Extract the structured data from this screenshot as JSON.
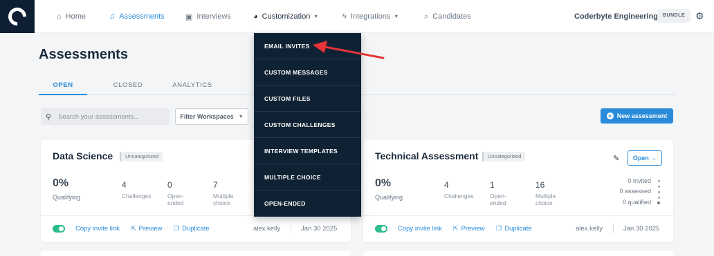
{
  "nav": {
    "items": [
      {
        "label": "Home",
        "icon": "home-icon"
      },
      {
        "label": "Assessments",
        "icon": "assessments-icon"
      },
      {
        "label": "Interviews",
        "icon": "interviews-icon"
      },
      {
        "label": "Customization",
        "icon": "palette-icon"
      },
      {
        "label": "Integrations",
        "icon": "bolt-icon"
      },
      {
        "label": "Candidates",
        "icon": "search-icon"
      }
    ],
    "org_name": "Coderbyte Engineering",
    "bundle_label": "BUNDLE"
  },
  "page": {
    "title": "Assessments",
    "tabs": [
      "OPEN",
      "CLOSED",
      "ANALYTICS"
    ],
    "search_placeholder": "Search your assessments...",
    "filter_label": "Filter Workspaces",
    "new_button_label": "New assessment"
  },
  "dropdown": {
    "items": [
      "EMAIL INVITES",
      "CUSTOM MESSAGES",
      "CUSTOM FILES",
      "CUSTOM CHALLENGES",
      "INTERVIEW TEMPLATES",
      "MULTIPLE CHOICE",
      "OPEN-ENDED"
    ]
  },
  "cards": [
    {
      "title": "Data Science",
      "tag": "Uncategorized",
      "qualifying_pct": "0%",
      "qualifying_label": "Qualifying",
      "challenges": "4",
      "challenges_label": "Challenges",
      "open_ended": "0",
      "open_ended_label_1": "Open-",
      "open_ended_label_2": "ended",
      "multiple_choice": "7",
      "multiple_choice_label_1": "Multiple",
      "multiple_choice_label_2": "choice",
      "copy_link": "Copy invite link",
      "preview": "Preview",
      "duplicate": "Duplicate",
      "owner": "alex.kelly",
      "date": "Jan 30 2025"
    },
    {
      "title": "Technical Assessment",
      "tag": "Uncategorized",
      "open_label": "Open",
      "qualifying_pct": "0%",
      "qualifying_label": "Qualifying",
      "challenges": "4",
      "challenges_label": "Challenges",
      "open_ended": "1",
      "open_ended_label_1": "Open-",
      "open_ended_label_2": "ended",
      "multiple_choice": "16",
      "multiple_choice_label_1": "Multiple",
      "multiple_choice_label_2": "choice",
      "invited": "0 invited",
      "assessed": "0 assessed",
      "qualified": "0 qualified",
      "copy_link": "Copy invite link",
      "preview": "Preview",
      "duplicate": "Duplicate",
      "owner": "alex.kelly",
      "date": "Jan 30 2025"
    }
  ],
  "colors": {
    "accent": "#2a8bd9",
    "dropdown_bg": "#0f2233",
    "toggle": "#2ebd8a",
    "arrow": "#e5343a"
  }
}
